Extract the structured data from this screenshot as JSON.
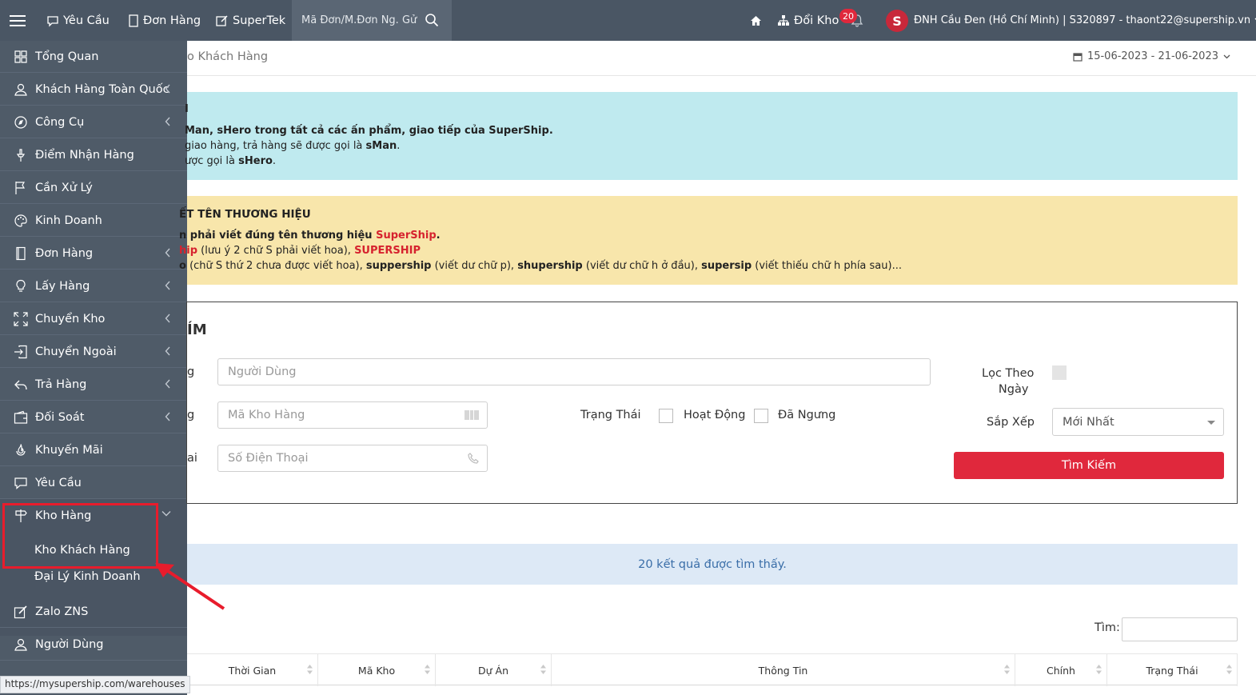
{
  "topbar": {
    "menu_icon": "hamburger-icon",
    "nav": [
      {
        "label": "Yêu Cầu",
        "icon": "chat-icon"
      },
      {
        "label": "Đơn Hàng",
        "icon": "document-icon"
      },
      {
        "label": "SuperTek",
        "icon": "edit-icon"
      }
    ],
    "search_placeholder": "Mã Đơn/M.Đơn Ng. Gử",
    "home_icon": "home-icon",
    "switch_warehouse_label": "Đổi Kho",
    "notification_count": "20",
    "avatar_letter": "S",
    "account_label": "ĐNH Cầu Đen (Hồ Chí Minh) | S320897 - thaont22@supership.vn"
  },
  "sidebar": {
    "items": [
      {
        "label": "Tổng Quan",
        "icon": "grid-icon",
        "chevron": false
      },
      {
        "label": "Khách Hàng Toàn Quốc",
        "icon": "user-icon",
        "chevron": true
      },
      {
        "label": "Công Cụ",
        "icon": "compass-icon",
        "chevron": true
      },
      {
        "label": "Điểm Nhận Hàng",
        "icon": "pin-icon",
        "chevron": false
      },
      {
        "label": "Cần Xử Lý",
        "icon": "flag-icon",
        "chevron": false
      },
      {
        "label": "Kinh Doanh",
        "icon": "palette-icon",
        "chevron": false
      },
      {
        "label": "Đơn Hàng",
        "icon": "document-icon",
        "chevron": true
      },
      {
        "label": "Lấy Hàng",
        "icon": "bulb-icon",
        "chevron": true
      },
      {
        "label": "Chuyển Kho",
        "icon": "expand-icon",
        "chevron": true
      },
      {
        "label": "Chuyển Ngoài",
        "icon": "login-icon",
        "chevron": true
      },
      {
        "label": "Trả Hàng",
        "icon": "reply-icon",
        "chevron": true
      },
      {
        "label": "Đối Soát",
        "icon": "wallet-icon",
        "chevron": true
      },
      {
        "label": "Khuyến Mãi",
        "icon": "fire-icon",
        "chevron": false
      },
      {
        "label": "Yêu Cầu",
        "icon": "chat-icon",
        "chevron": false
      }
    ],
    "expanded": {
      "label": "Kho Hàng",
      "icon": "signpost-icon"
    },
    "subitems": [
      {
        "label": "Kho Khách Hàng"
      },
      {
        "label": "Đại Lý Kinh Doanh"
      }
    ],
    "after": [
      {
        "label": "Zalo ZNS",
        "icon": "edit-icon"
      },
      {
        "label": "Người Dùng",
        "icon": "user-icon"
      }
    ]
  },
  "main": {
    "breadcrumb": "o Khách Hàng",
    "date_range": "15-06-2023 - 21-06-2023",
    "info": {
      "title": "I",
      "line1_bold": "Man, sHero trong tất cả các ấn phẩm, giao tiếp của SuperShip.",
      "line2_pre": " giao hàng, trả hàng sẽ được gọi là ",
      "line2_bold": "sMan",
      "line2_post": ".",
      "line3_pre": "ược gọi là ",
      "line3_bold": "sHero",
      "line3_post": "."
    },
    "warning": {
      "title": "ẾT TÊN THƯƠNG HIỆU",
      "line1_bold": "n phải viết đúng tên thương hiệu ",
      "line1_red": "SuperShip",
      "line1_post": ".",
      "line2_red1": "hip",
      "line2_mid": " (lưu ý 2 chữ S phải viết hoa), ",
      "line2_red2": "SUPERSHIP",
      "line3_a": "o",
      "line3_b": " (chữ S thứ 2 chưa được viết hoa), ",
      "line3_c": "suppership",
      "line3_d": " (viết dư chữ p), ",
      "line3_e": "shupership",
      "line3_f": " (viết dư chữ h ở đầu), ",
      "line3_g": "supersip",
      "line3_h": " (viết thiếu chữ h phía sau)..."
    },
    "search": {
      "title": "ÍM",
      "row1_label": "g",
      "user_placeholder": "Người Dùng",
      "row2_label": "g",
      "warehouse_placeholder": "Mã Kho Hàng",
      "row3_label": "ai",
      "phone_placeholder": "Số Điện Thoại",
      "status_label": "Trạng Thái",
      "active_label": "Hoạt Động",
      "stopped_label": "Đã Ngưng",
      "filter_date_label_1": "Lọc Theo",
      "filter_date_label_2": "Ngày",
      "sort_label": "Sắp Xếp",
      "sort_value": "Mới Nhất",
      "search_button": "Tìm Kiếm"
    },
    "result_text": "20 kết quả được tìm thấy.",
    "find_label": "Tìm:",
    "table_headers": [
      "Thời Gian",
      "Mã Kho",
      "Dự Án",
      "Thông Tin",
      "Chính",
      "Trạng Thái"
    ]
  },
  "statusbar_url": "https://mysupership.com/warehouses",
  "colors": {
    "topbar": "#4a5664",
    "sidebar": "#4f5b68",
    "accent_red": "#e0283c",
    "info_bg": "#bfeaef",
    "warning_bg": "#f8e6ab",
    "result_bg": "#dde9f6"
  }
}
